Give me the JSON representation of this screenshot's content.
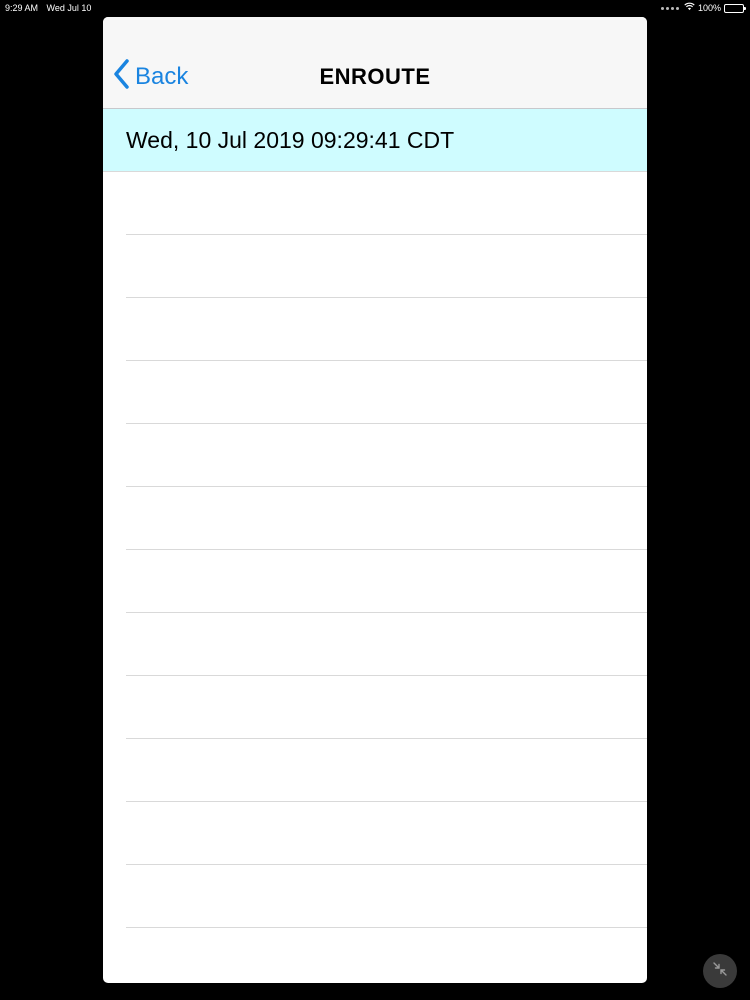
{
  "status_bar": {
    "time": "9:29 AM",
    "date": "Wed Jul 10",
    "battery": "100%"
  },
  "nav": {
    "back_label": "Back",
    "title": "ENROUTE"
  },
  "list": {
    "selected_row": "Wed, 10 Jul 2019 09:29:41 CDT"
  },
  "colors": {
    "accent": "#1a84e0",
    "selected_row_bg": "#cffcff",
    "background": "#000000"
  },
  "icons": {
    "back": "chevron-left-icon",
    "wifi": "wifi-icon",
    "battery": "battery-icon",
    "minimize": "minimize-arrows-icon"
  }
}
